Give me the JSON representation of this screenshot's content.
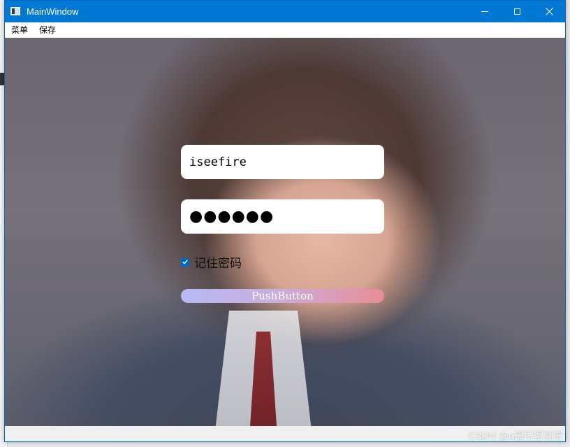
{
  "window": {
    "title": "MainWindow",
    "accent": "#0078d4"
  },
  "menubar": {
    "items": [
      "菜单",
      "保存"
    ]
  },
  "form": {
    "username_value": "iseefire",
    "password_masked": "●●●●●●",
    "remember_label": "记住密码",
    "remember_checked": true,
    "button_label": "PushButton",
    "button_gradient": [
      "#b8b9f4",
      "#e88d96"
    ]
  },
  "watermark": "CSDN @a篇博客就滑",
  "icons": [
    "app-window-icon",
    "minimize-icon",
    "maximize-icon",
    "close-icon",
    "check-icon"
  ]
}
